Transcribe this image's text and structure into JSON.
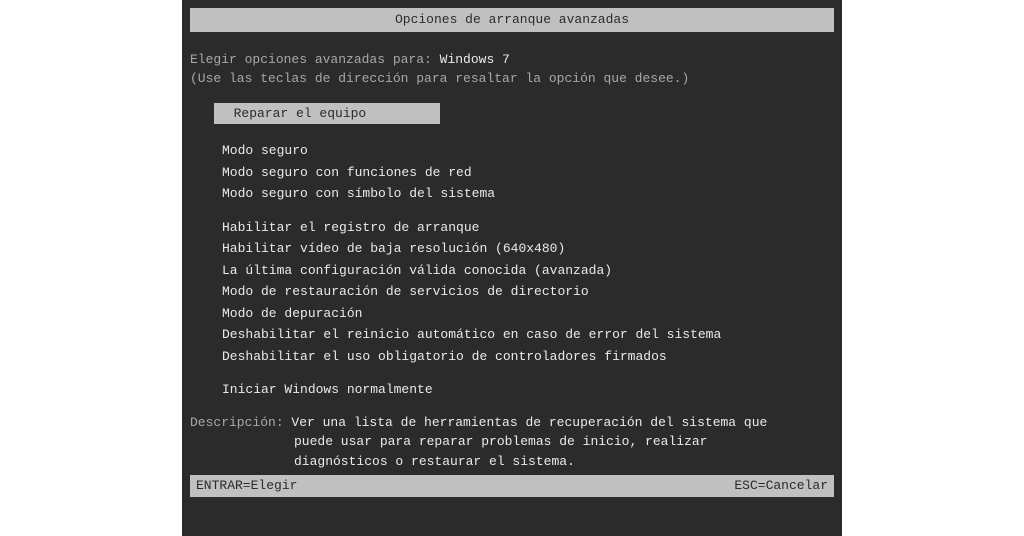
{
  "title": "Opciones de arranque avanzadas",
  "intro": {
    "label": "Elegir opciones avanzadas para: ",
    "value": "Windows 7",
    "hint": "(Use las teclas de dirección para resaltar la opción que desee.)"
  },
  "selectedItem": "  Reparar el equipo         ",
  "menu": {
    "group1": [
      "Modo seguro",
      "Modo seguro con funciones de red",
      "Modo seguro con símbolo del sistema"
    ],
    "group2": [
      "Habilitar el registro de arranque",
      "Habilitar vídeo de baja resolución (640x480)",
      "La última configuración válida conocida (avanzada)",
      "Modo de restauración de servicios de directorio",
      "Modo de depuración",
      "Deshabilitar el reinicio automático en caso de error del sistema",
      "Deshabilitar el uso obligatorio de controladores firmados"
    ],
    "group3": [
      "Iniciar Windows normalmente"
    ]
  },
  "description": {
    "label": "Descripción: ",
    "line1": "Ver una lista de herramientas de recuperación del sistema que",
    "line2": "puede usar para reparar problemas de inicio, realizar",
    "line3": "diagnósticos o restaurar el sistema."
  },
  "footer": {
    "enter": "ENTRAR=Elegir",
    "esc": "ESC=Cancelar"
  }
}
